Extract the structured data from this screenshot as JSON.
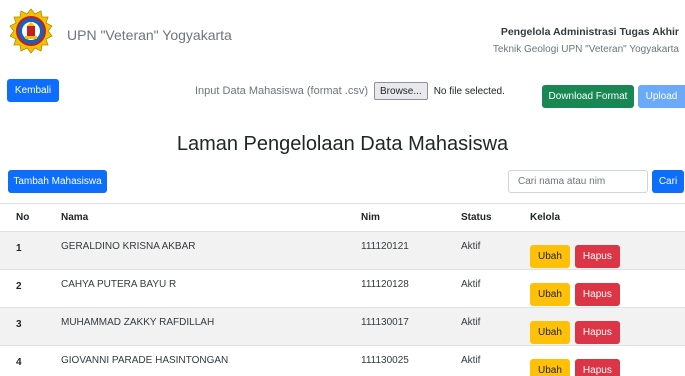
{
  "header": {
    "app_name": "UPN \"Veteran\" Yogyakarta",
    "right_title": "Pengelola Administrasi Tugas Akhir",
    "right_subtitle": "Teknik Geologi UPN \"Veteran\" Yogyakarta"
  },
  "toolbar": {
    "back_label": "Kembali",
    "upload_label": "Input Data Mahasiswa (format .csv)",
    "browse_label": "Browse...",
    "file_status": "No file selected.",
    "download_label": "Download Format",
    "upload_button": "Upload"
  },
  "page_title": "Laman Pengelolaan Data Mahasiswa",
  "actions": {
    "add_label": "Tambah Mahasiswa",
    "search_placeholder": "Cari nama atau nim",
    "search_button": "Cari"
  },
  "table": {
    "headers": {
      "no": "No",
      "nama": "Nama",
      "nim": "Nim",
      "status": "Status",
      "kelola": "Kelola"
    },
    "edit_label": "Ubah",
    "delete_label": "Hapus",
    "rows": [
      {
        "no": "1",
        "nama": "GERALDINO KRISNA AKBAR",
        "nim": "111120121",
        "status": "Aktif"
      },
      {
        "no": "2",
        "nama": "CAHYA PUTERA BAYU R",
        "nim": "111120128",
        "status": "Aktif"
      },
      {
        "no": "3",
        "nama": "MUHAMMAD ZAKKY RAFDILLAH",
        "nim": "111130017",
        "status": "Aktif"
      },
      {
        "no": "4",
        "nama": "GIOVANNI PARADE HASINTONGAN",
        "nim": "111130025",
        "status": "Aktif"
      }
    ]
  },
  "colors": {
    "primary": "#0d6efd",
    "success": "#198754",
    "warning": "#ffc107",
    "danger": "#dc3545"
  },
  "icons": {
    "logo": "upn-emblem"
  }
}
